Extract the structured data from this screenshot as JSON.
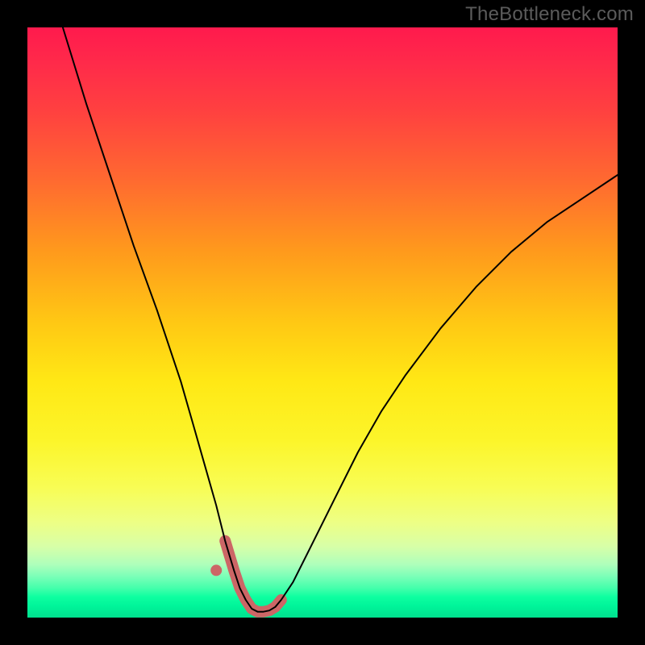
{
  "watermark": "TheBottleneck.com",
  "chart_data": {
    "type": "line",
    "title": "",
    "xlabel": "",
    "ylabel": "",
    "xlim": [
      0,
      100
    ],
    "ylim": [
      0,
      100
    ],
    "grid": false,
    "legend": false,
    "note": "Axes unlabeled; values estimated from pixel positions (percent of plot area).",
    "series": [
      {
        "name": "main-curve",
        "color": "#000000",
        "stroke_width": 2,
        "x": [
          6,
          10,
          14,
          18,
          22,
          26,
          28,
          30,
          32,
          33.5,
          35,
          36,
          37,
          38,
          39,
          40,
          41,
          42,
          43,
          45,
          48,
          52,
          56,
          60,
          64,
          70,
          76,
          82,
          88,
          94,
          100
        ],
        "y": [
          100,
          87,
          75,
          63,
          52,
          40,
          33,
          26,
          19,
          13,
          8,
          5,
          3,
          1.5,
          1.0,
          1.0,
          1.2,
          1.8,
          3,
          6,
          12,
          20,
          28,
          35,
          41,
          49,
          56,
          62,
          67,
          71,
          75
        ]
      },
      {
        "name": "highlight-segment",
        "color": "#cc6666",
        "stroke_width": 14,
        "linecap": "round",
        "x": [
          33.5,
          35,
          36,
          37,
          38,
          39,
          40,
          41,
          42,
          43
        ],
        "y": [
          13,
          8,
          5,
          3,
          1.5,
          1.0,
          1.0,
          1.2,
          1.8,
          3
        ]
      },
      {
        "name": "highlight-dot",
        "type": "scatter",
        "color": "#cc6666",
        "radius": 7,
        "x": [
          32
        ],
        "y": [
          8
        ]
      }
    ],
    "background_gradient": {
      "direction": "top-to-bottom",
      "stops": [
        {
          "pos": 0.0,
          "color": "#ff1a4d"
        },
        {
          "pos": 0.26,
          "color": "#ff6a30"
        },
        {
          "pos": 0.5,
          "color": "#ffc814"
        },
        {
          "pos": 0.7,
          "color": "#fcf52a"
        },
        {
          "pos": 0.88,
          "color": "#d7ffa8"
        },
        {
          "pos": 1.0,
          "color": "#00e08e"
        }
      ]
    }
  }
}
